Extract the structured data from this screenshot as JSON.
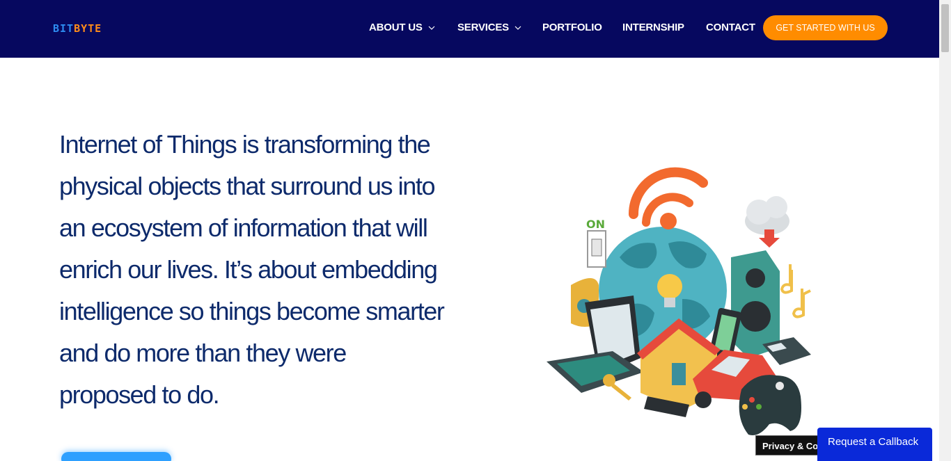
{
  "header": {
    "logo_part1": "BIT",
    "logo_part2": "BYTE",
    "nav": {
      "about": "ABOUT US",
      "services": "SERVICES",
      "portfolio": "PORTFOLIO",
      "internship": "INTERNSHIP",
      "contact": "CONTACT"
    },
    "cta_label": "GET STARTED WITH US"
  },
  "hero": {
    "lines": [
      "Internet of Things is transforming the",
      "physical objects that surround us into",
      "an ecosystem of information that will",
      "enrich our lives.  It’s about embedding",
      "intelligence so things become smarter",
      "and do more than they were",
      "proposed to do."
    ]
  },
  "illustration": {
    "on_label": "ON"
  },
  "widgets": {
    "privacy_label": "Privacy & Cookies",
    "callback_label": "Request a Callback"
  },
  "colors": {
    "header_bg": "#06085f",
    "accent_orange": "#ff8c00",
    "heading_blue": "#0d2a6b",
    "callback_blue": "#0a29d9"
  }
}
